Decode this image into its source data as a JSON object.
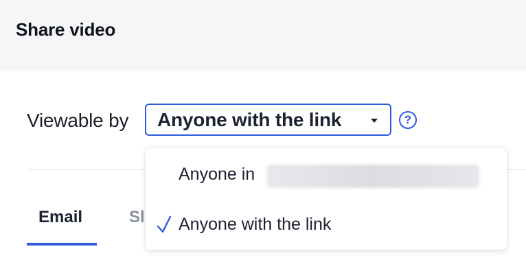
{
  "dialog": {
    "title": "Share video"
  },
  "viewable": {
    "label": "Viewable by",
    "selected": "Anyone with the link",
    "help_glyph": "?"
  },
  "dropdown": {
    "options": [
      {
        "label": "Anyone in",
        "checked": false,
        "redacted_suffix": true
      },
      {
        "label": "Anyone with the link",
        "checked": true
      }
    ]
  },
  "tabs": [
    {
      "label": "Email",
      "active": true
    },
    {
      "label": "Sl",
      "active": false
    }
  ],
  "colors": {
    "accent": "#2e5bdc",
    "header_bg": "#f5f6f8",
    "text": "#1b2230"
  },
  "icons": {
    "dropdown": "caret-down-icon",
    "help": "help-circle-icon",
    "check": "check-icon"
  }
}
